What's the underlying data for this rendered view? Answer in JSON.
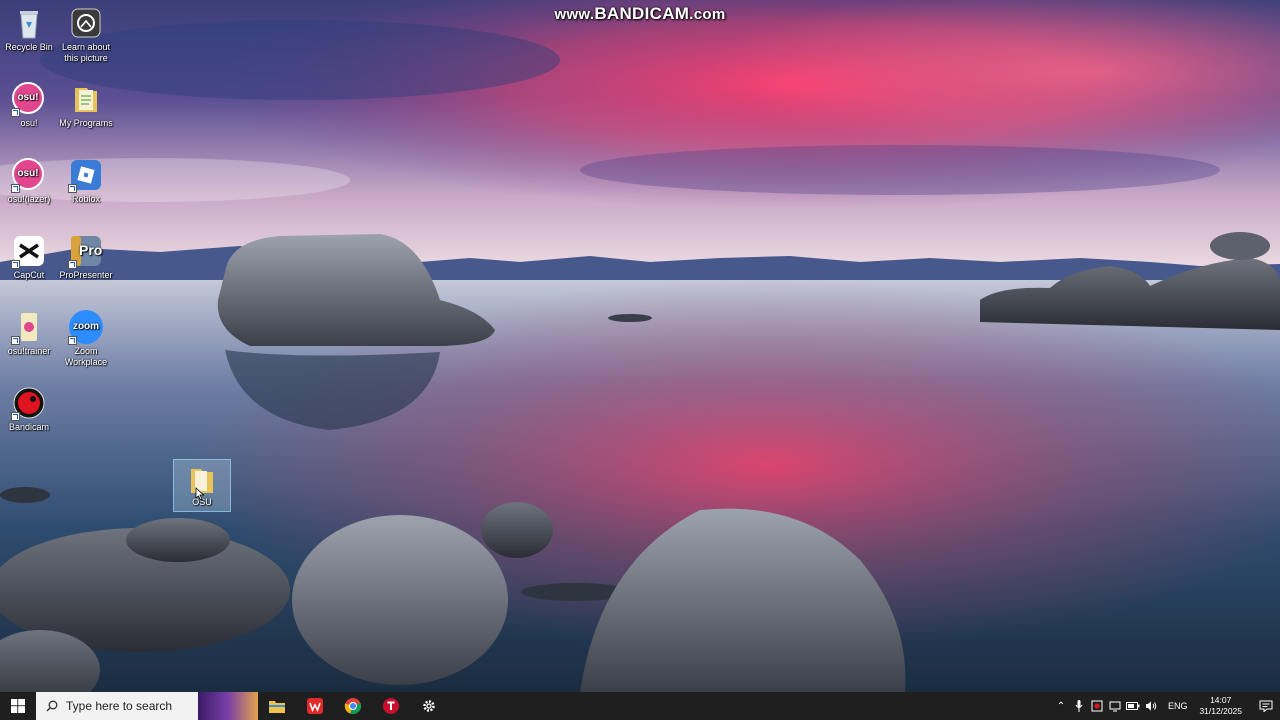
{
  "watermark": {
    "prefix": "www.",
    "brand": "BANDICAM",
    "suffix": ".com"
  },
  "desktop": {
    "icons": [
      {
        "label": "Recycle Bin"
      },
      {
        "label": "Learn about this picture"
      },
      {
        "label": "osu!"
      },
      {
        "label": "My Programs"
      },
      {
        "label": "osu!(lazer)"
      },
      {
        "label": "Roblox"
      },
      {
        "label": "CapCut"
      },
      {
        "label": "ProPresenter"
      },
      {
        "label": "osu!trainer"
      },
      {
        "label": "Zoom Workplace"
      },
      {
        "label": "Bandicam"
      },
      {
        "label": "OSU"
      }
    ],
    "osu_badge_text": "osu!",
    "pro_badge_text": "Pro",
    "zoom_badge_text": "zoom"
  },
  "taskbar": {
    "search_placeholder": "Type here to search",
    "apps": [
      "file-explorer",
      "wps-office",
      "chrome",
      "t-app",
      "settings"
    ],
    "language": "ENG",
    "time": "14:07",
    "date": "31/12/2025"
  },
  "colors": {
    "taskbar_bg": "#1f1f1f",
    "osu_pink": "#e1468e",
    "zoom_blue": "#2d8cff",
    "roblox_blue": "#3a7bd5"
  }
}
